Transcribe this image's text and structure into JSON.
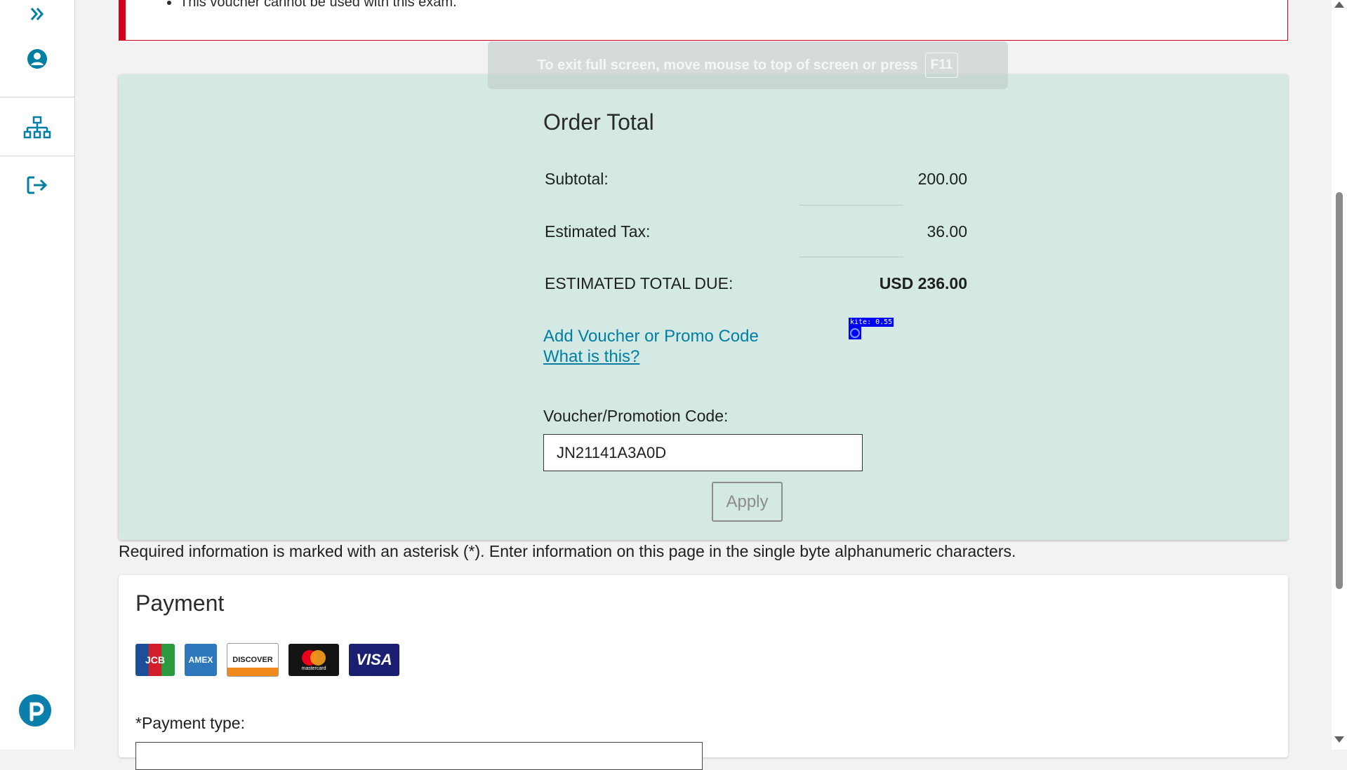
{
  "sidebar": {
    "items": [
      {
        "icon": "expand-chevrons-icon"
      },
      {
        "icon": "user-account-icon"
      },
      {
        "icon": "sitemap-icon"
      },
      {
        "icon": "sign-out-icon"
      }
    ],
    "logo_icon": "pearson-logo-icon",
    "accent": "#0b7fab"
  },
  "error": {
    "message": "This voucher cannot be used with this exam.",
    "color": "#d3001c"
  },
  "fullscreen_toast": {
    "text": "To exit full screen, move mouse to top of screen or press",
    "key": "F11"
  },
  "order_total": {
    "title": "Order Total",
    "rows": [
      {
        "label": "Subtotal:",
        "value": "200.00"
      },
      {
        "label": "Estimated Tax:",
        "value": "36.00"
      },
      {
        "label": "ESTIMATED TOTAL DUE:",
        "value": "USD 236.00"
      }
    ],
    "add_voucher_link": "Add Voucher or Promo Code",
    "what_is_this_link": "What is this?",
    "kite_label": "kite: 0.55",
    "voucher_label": "Voucher/Promotion Code:",
    "voucher_value": "JN21141A3A0D",
    "apply_label": "Apply",
    "background": "#d4e9e3"
  },
  "required_note": "Required information is marked with an asterisk (*). Enter information on this page in the single byte alphanumeric characters.",
  "payment": {
    "title": "Payment",
    "cards": [
      {
        "name": "JCB",
        "icon": "jcb-card-icon"
      },
      {
        "name": "AMEX",
        "icon": "amex-card-icon"
      },
      {
        "name": "DISCOVER",
        "icon": "discover-card-icon"
      },
      {
        "name": "mastercard",
        "icon": "mastercard-card-icon"
      },
      {
        "name": "VISA",
        "icon": "visa-card-icon"
      }
    ],
    "payment_type_label": "*Payment type:"
  }
}
